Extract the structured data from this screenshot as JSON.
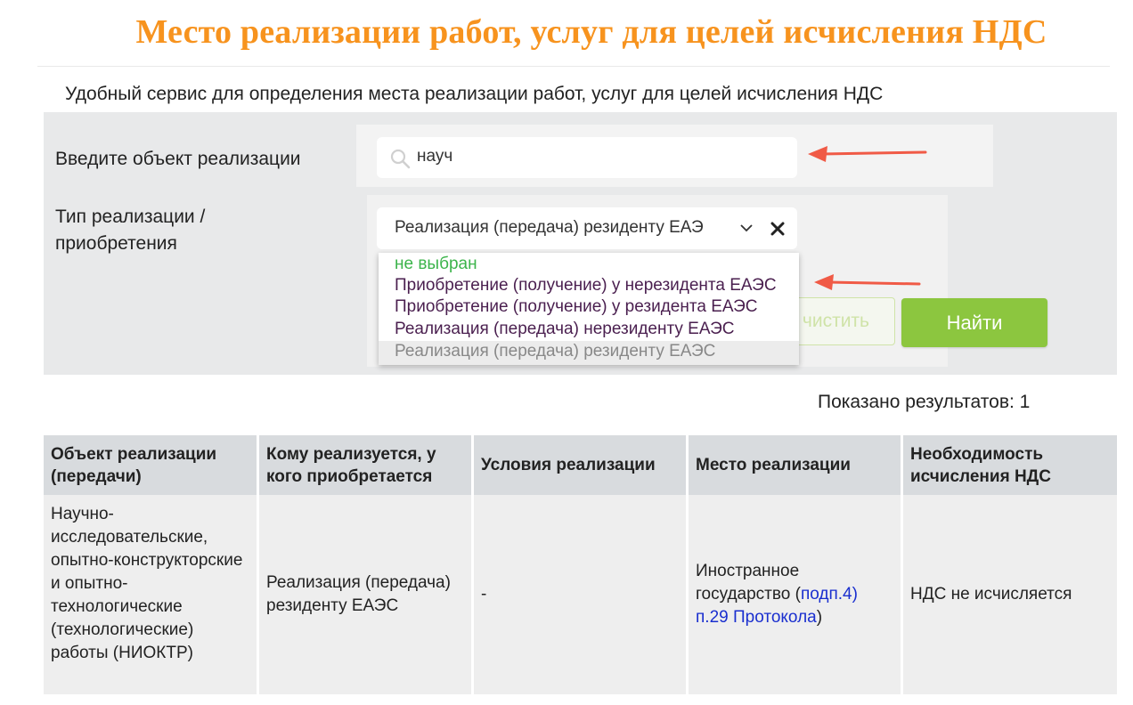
{
  "page": {
    "title": "Место реализации работ, услуг для целей исчисления НДС",
    "subtitle": "Удобный сервис для определения места реализации работ, услуг для целей исчисления НДС"
  },
  "form": {
    "object_label": "Введите объект реализации",
    "search_value": "науч",
    "type_label": "Тип реализации / приобретения",
    "type_selected": "Реализация (передача) резиденту ЕАЭ",
    "clear_button": "чистить",
    "find_button": "Найти",
    "dropdown_options": [
      "не выбран",
      "Приобретение (получение) у нерезидента ЕАЭС",
      "Приобретение (получение) у резидента ЕАЭС",
      "Реализация (передача) нерезиденту ЕАЭС",
      "Реализация (передача) резиденту ЕАЭС"
    ]
  },
  "results": {
    "count_text": "Показано результатов: 1"
  },
  "table": {
    "headers": [
      "Объект реализации (передачи)",
      "Кому реализуется, у кого приобретается",
      "Условия реализации",
      "Место реализации",
      "Необходимость исчисления НДС"
    ],
    "rows": [
      {
        "object": "Научно-исследовательские, опытно-конструкторские и опытно-технологические (технологические) работы (НИОКТР)",
        "whom": "Реализация (передача) резиденту ЕАЭС",
        "conditions": "-",
        "place_text": "Иностранное государство (",
        "place_link": "подп.4) п.29 Протокола",
        "place_close": ")",
        "vat": "НДС не исчисляется"
      }
    ]
  },
  "colors": {
    "title": "#f7931e",
    "find_button": "#8cc63f",
    "annotation_arrow": "#f05a46",
    "link": "#1a2fcf"
  }
}
